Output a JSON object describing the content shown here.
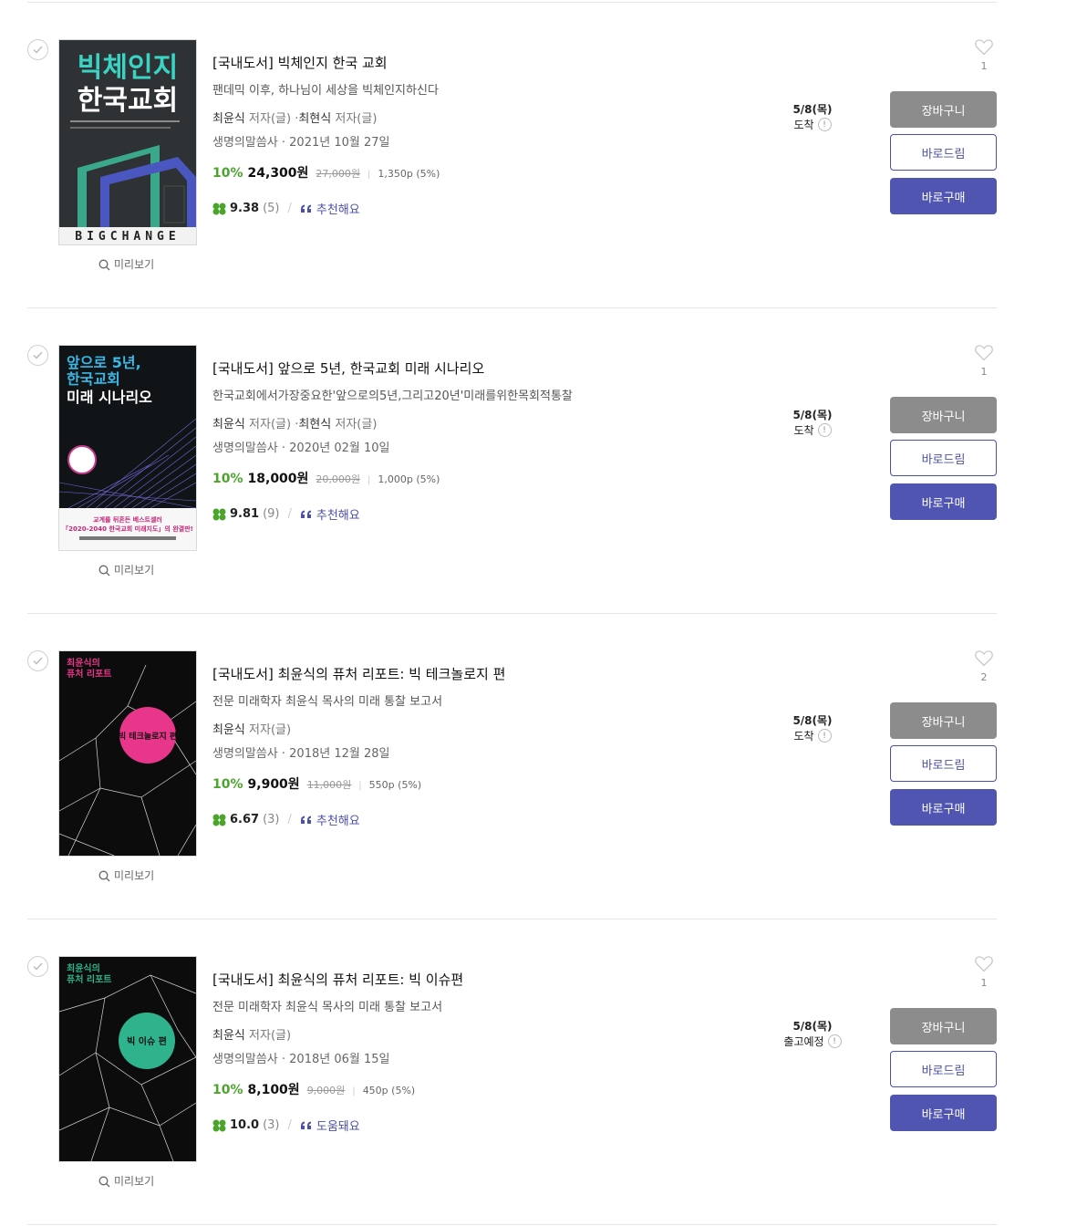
{
  "common": {
    "preview_label": "미리보기",
    "cart_label": "장바구니",
    "gift_label": "바로드림",
    "buy_label": "바로구매",
    "author_role": "저자(글)"
  },
  "books": [
    {
      "title": "[국내도서] 빅체인지 한국 교회",
      "subtitle": "팬데믹 이후, 하나님이 세상을 빅체인지하신다",
      "authors": [
        "최윤식",
        "최현식"
      ],
      "publisher_date": "생명의말씀사 · 2021년 10월 27일",
      "discount": "10%",
      "sale_price": "24,300원",
      "orig_price": "27,000원",
      "points": "1,350p (5%)",
      "score": "9.38",
      "review_count": "(5)",
      "review_tag": "추천해요",
      "delivery_date": "5/8(목)",
      "delivery_status": "도착",
      "wish_count": "1",
      "cover": {
        "line1": "빅체인지",
        "line2": "한국교회",
        "bottom": "BIGCHANGE"
      }
    },
    {
      "title": "[국내도서] 앞으로 5년, 한국교회 미래 시나리오",
      "subtitle": "한국교회에서가장중요한'앞으로의5년,그리고20년'미래를위한목회적통찰",
      "authors": [
        "최윤식",
        "최현식"
      ],
      "publisher_date": "생명의말씀사 · 2020년 02월 10일",
      "discount": "10%",
      "sale_price": "18,000원",
      "orig_price": "20,000원",
      "points": "1,000p (5%)",
      "score": "9.81",
      "review_count": "(9)",
      "review_tag": "추천해요",
      "delivery_date": "5/8(목)",
      "delivery_status": "도착",
      "wish_count": "1",
      "cover": {
        "line1": "앞으로 5년,",
        "line2": "한국교회",
        "line3": "미래 시나리오",
        "band1": "교계를 뒤흔든 베스트셀러",
        "band2": "「2020-2040 한국교회 미래지도」의 완결판!"
      }
    },
    {
      "title": "[국내도서] 최윤식의 퓨처 리포트: 빅 테크놀로지 편",
      "subtitle": "전문 미래학자 최윤식 목사의 미래 통찰 보고서",
      "authors": [
        "최윤식"
      ],
      "publisher_date": "생명의말씀사 · 2018년 12월 28일",
      "discount": "10%",
      "sale_price": "9,900원",
      "orig_price": "11,000원",
      "points": "550p (5%)",
      "score": "6.67",
      "review_count": "(3)",
      "review_tag": "추천해요",
      "delivery_date": "5/8(목)",
      "delivery_status": "도착",
      "wish_count": "2",
      "cover": {
        "line1": "최윤식의",
        "line2": "퓨처 리포트",
        "circle": "빅 테크놀로지 편",
        "circle_color": "#e8368a"
      }
    },
    {
      "title": "[국내도서] 최윤식의 퓨처 리포트: 빅 이슈편",
      "subtitle": "전문 미래학자 최윤식 목사의 미래 통찰 보고서",
      "authors": [
        "최윤식"
      ],
      "publisher_date": "생명의말씀사 · 2018년 06월 15일",
      "discount": "10%",
      "sale_price": "8,100원",
      "orig_price": "9,000원",
      "points": "450p (5%)",
      "score": "10.0",
      "review_count": "(3)",
      "review_tag": "도움돼요",
      "delivery_date": "5/8(목)",
      "delivery_status": "출고예정",
      "wish_count": "1",
      "cover": {
        "line1": "최윤식의",
        "line2": "퓨처 리포트",
        "circle": "빅 이슈 편",
        "circle_color": "#2fb38c"
      }
    }
  ],
  "colors": {
    "accent": "#5055b1",
    "discount_green": "#4ba52d",
    "cart_gray": "#8c8c8c",
    "review_link": "#4a4fa9"
  }
}
